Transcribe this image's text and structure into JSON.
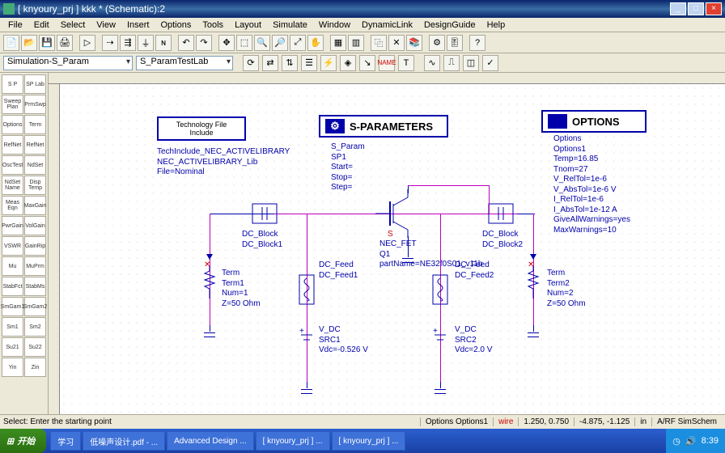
{
  "window": {
    "title": "[ knyoury_prj ] kkk * (Schematic):2"
  },
  "menu": [
    "File",
    "Edit",
    "Select",
    "View",
    "Insert",
    "Options",
    "Tools",
    "Layout",
    "Simulate",
    "Window",
    "DynamicLink",
    "DesignGuide",
    "Help"
  ],
  "combos": {
    "sim": "Simulation-S_Param",
    "design": "S_ParamTestLab"
  },
  "palette": [
    [
      "S P",
      "SP Lab"
    ],
    [
      "Sweep Plan",
      "PrmSwp"
    ],
    [
      "Options",
      "Term"
    ],
    [
      "RefNet",
      "RefNet"
    ],
    [
      "OscTest",
      "NdSet"
    ],
    [
      "NdSet Name",
      "Disp Temp"
    ],
    [
      "Meas Eqn",
      "MaxGain"
    ],
    [
      "PwrGain",
      "VolGain"
    ],
    [
      "VSWR",
      "GainRip"
    ],
    [
      "Mu",
      "MuPrm"
    ],
    [
      "StabFct",
      "StabMs"
    ],
    [
      "SmGam1",
      "SmGam2"
    ],
    [
      "Sm1",
      "Sm2"
    ],
    [
      "Su21",
      "Su22"
    ],
    [
      "Yin",
      "Zin"
    ]
  ],
  "techbox": "Technology File\nInclude",
  "tech_labels": "TechInclude_NEC_ACTIVELIBRARY\nNEC_ACTIVELIBRARY_Lib\nFile=Nominal",
  "sparam_box": "S-PARAMETERS",
  "sparam_labels": "S_Param\nSP1\nStart=\nStop=\nStep=",
  "options_box": "OPTIONS",
  "options_labels": "Options\nOptions1\nTemp=16.85\nTnom=27\nV_RelTol=1e-6\nV_AbsTol=1e-6 V\nI_RelTol=1e-6\nI_AbsTol=1e-12 A\nGiveAllWarnings=yes\nMaxWarnings=10",
  "dcblock1": "DC_Block\nDC_Block1",
  "dcblock2": "DC_Block\nDC_Block2",
  "dcfeed1": "DC_Feed\nDC_Feed1",
  "dcfeed2": "DC_Feed\nDC_Feed2",
  "term1": "Term\nTerm1\nNum=1\nZ=50 Ohm",
  "term2": "Term\nTerm2\nNum=2\nZ=50 Ohm",
  "vdc1": "V_DC\nSRC1\nVdc=-0.526 V",
  "vdc2": "V_DC\nSRC2\nVdc=2.0 V",
  "fet": "NEC_FET\nQ1\npartName=NE32f0S01_v11b",
  "s_label": "S",
  "status": {
    "hint": "Select: Enter the starting point",
    "opts": "Options Options1",
    "wire": "wire",
    "coord1": "1.250, 0.750",
    "coord2": "-4.875, -1.125",
    "units": "in",
    "mode": "A/RF SimSchem"
  },
  "taskbar": {
    "start": "开始",
    "tasks": [
      "学习",
      "低噪声设计.pdf - ...",
      "Advanced Design ...",
      "[ knyoury_prj ] ...",
      "[ knyoury_prj ] ..."
    ],
    "time": "8:39"
  }
}
